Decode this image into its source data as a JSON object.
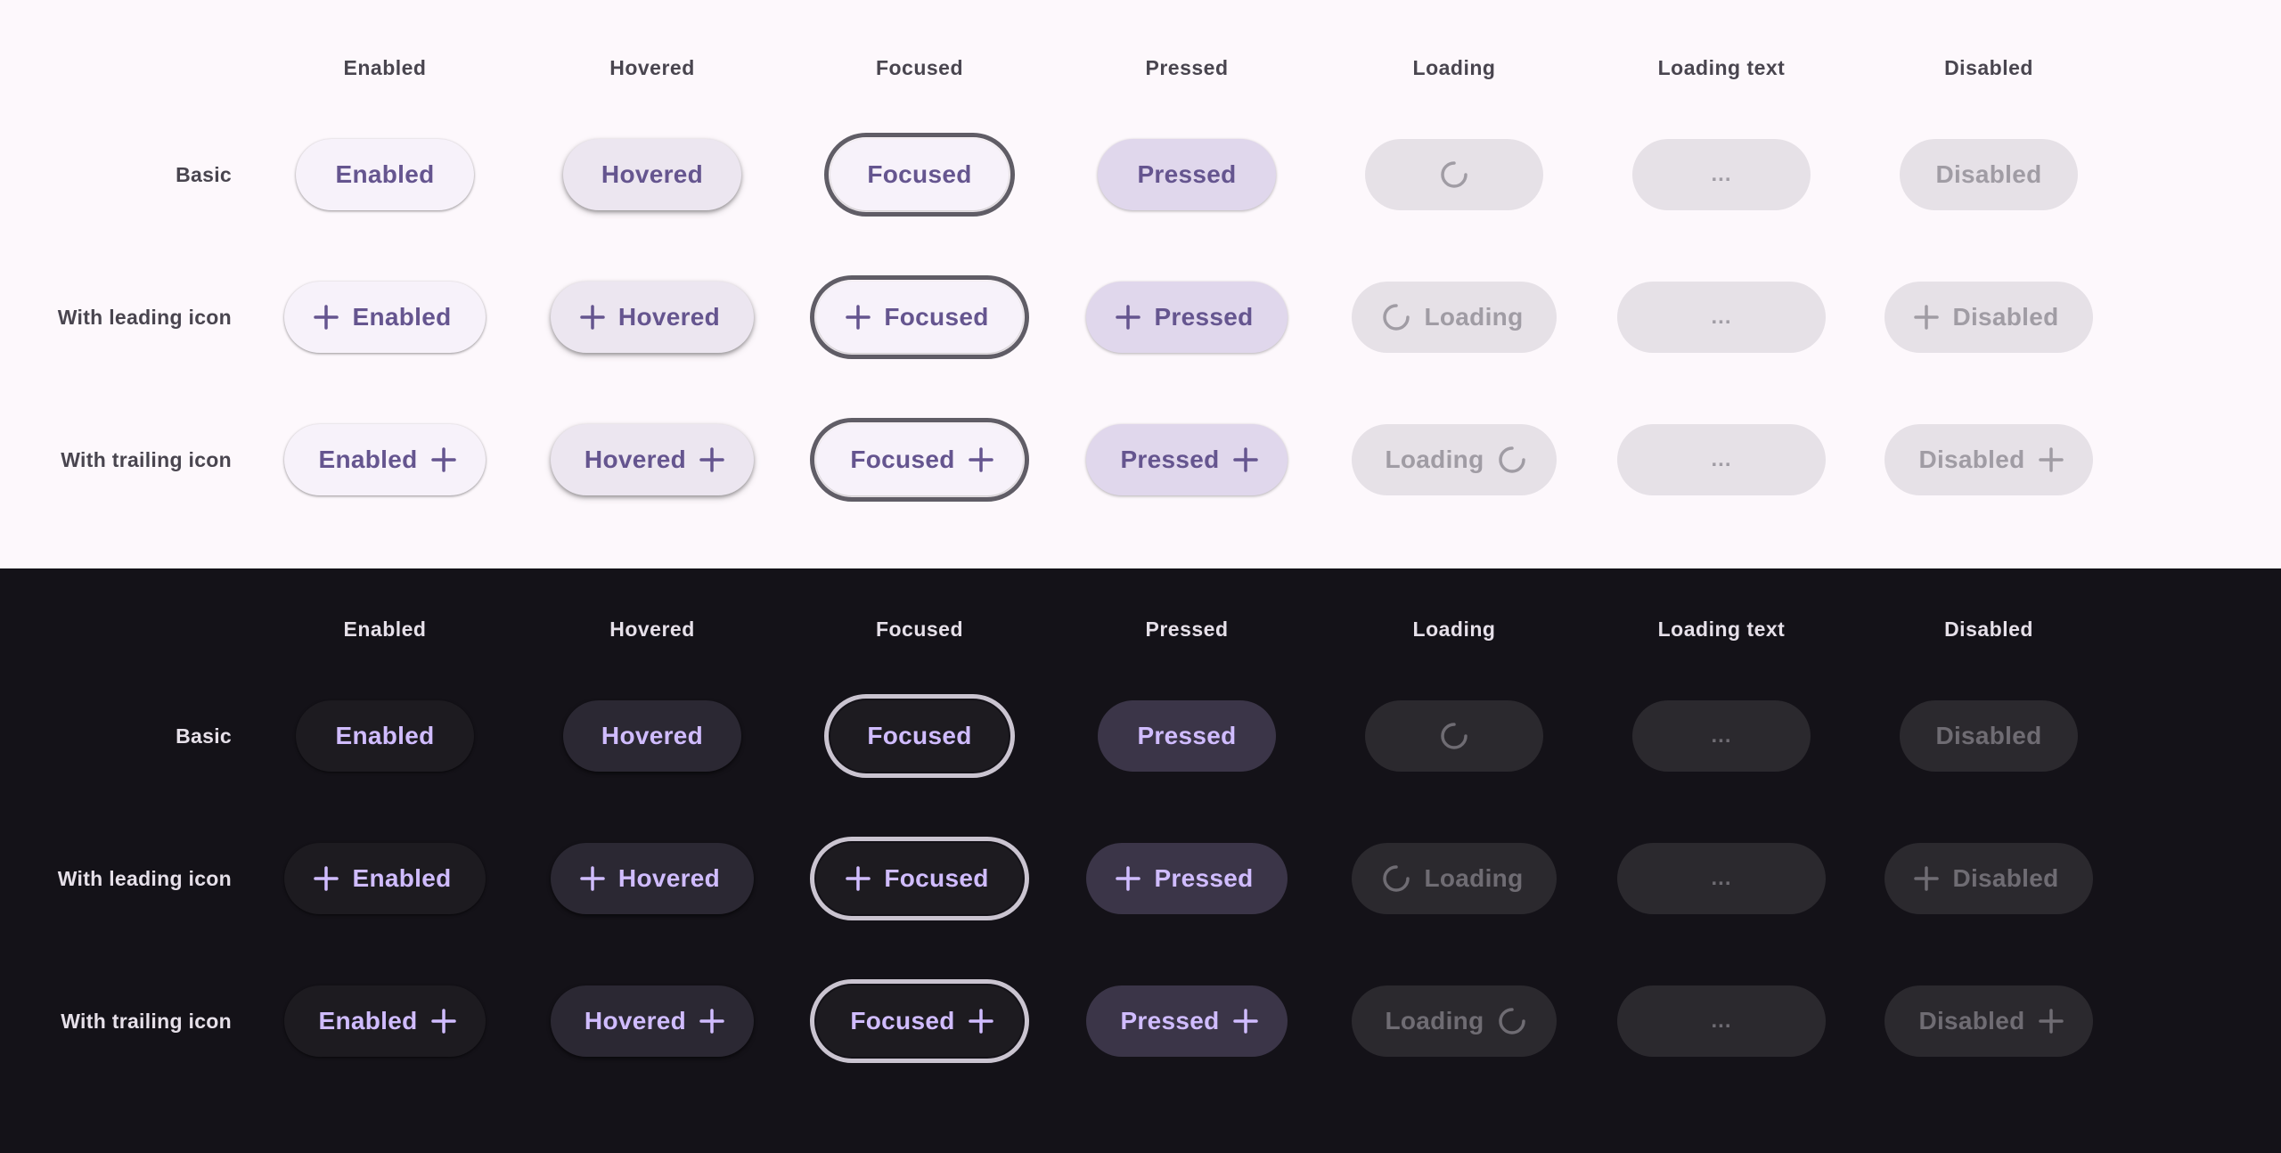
{
  "columns": [
    "Enabled",
    "Hovered",
    "Focused",
    "Pressed",
    "Loading",
    "Loading text",
    "Disabled"
  ],
  "rows": [
    "Basic",
    "With leading icon",
    "With trailing icon"
  ],
  "buttons": {
    "enabled": "Enabled",
    "hovered": "Hovered",
    "focused": "Focused",
    "pressed": "Pressed",
    "loading": "Loading",
    "loading_text": "...",
    "disabled": "Disabled"
  },
  "icons": {
    "add": "plus-icon",
    "spinner": "loading-spinner-icon"
  },
  "colors": {
    "light_bg": "#fdf8fc",
    "dark_bg": "#141218",
    "light_label": "#65558f",
    "dark_label": "#d0bcff"
  }
}
